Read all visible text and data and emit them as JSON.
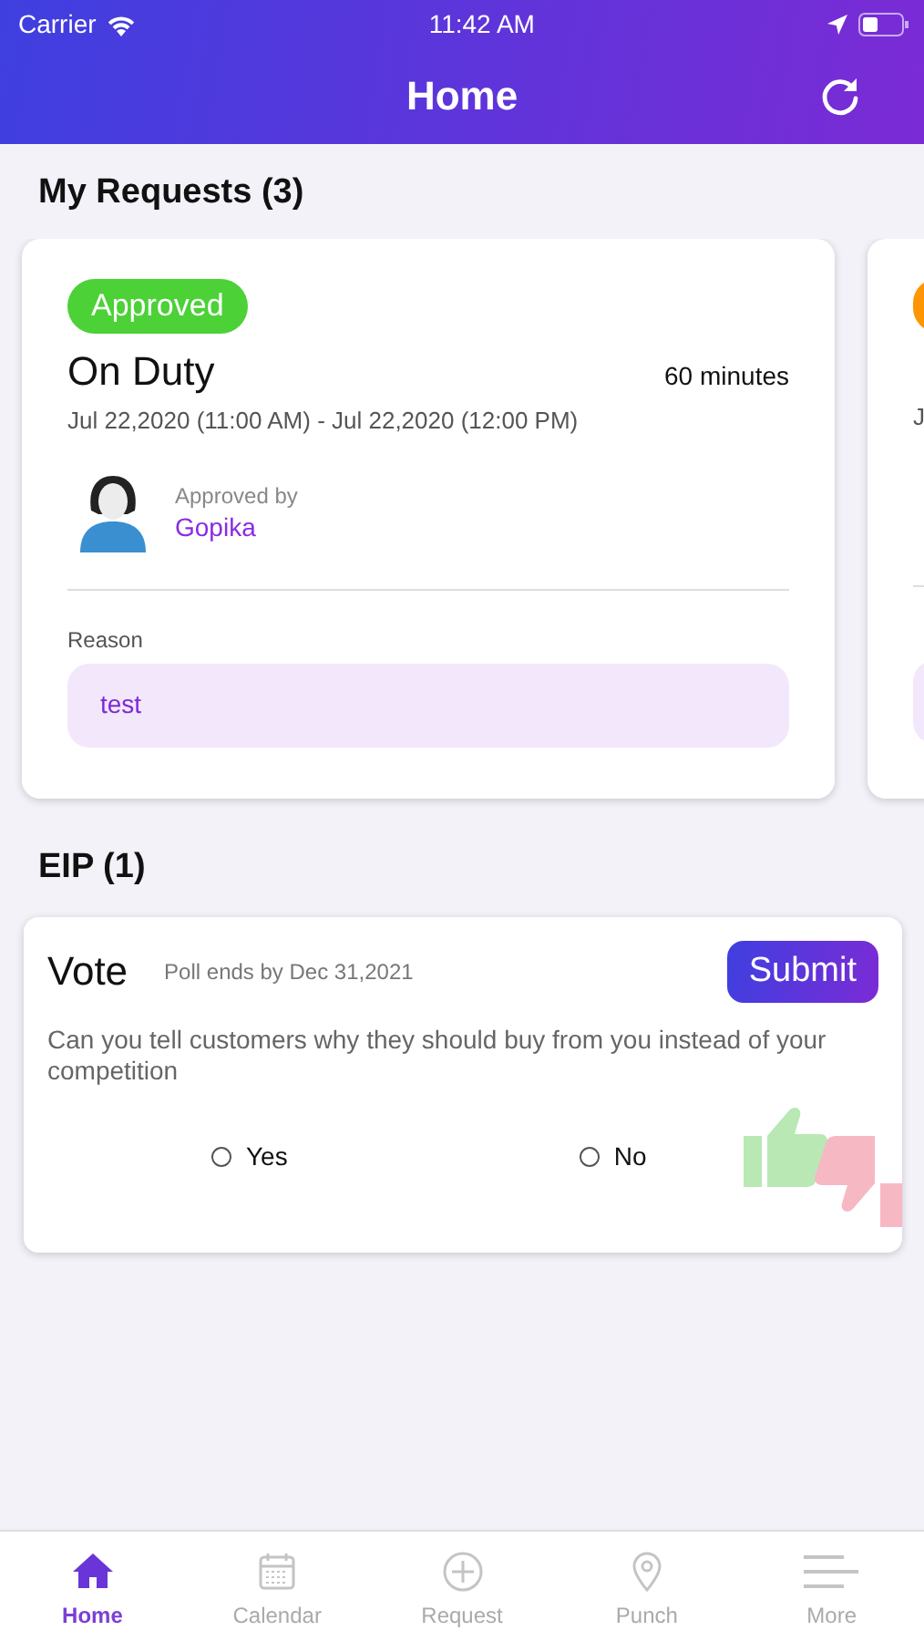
{
  "status_bar": {
    "carrier": "Carrier",
    "time": "11:42 AM"
  },
  "header": {
    "title": "Home"
  },
  "requests": {
    "heading": "My Requests (3)",
    "cards": [
      {
        "badge": "Approved",
        "color": "#4cd137",
        "title": "On Duty",
        "duration": "60 minutes",
        "dates": "Jul 22,2020 (11:00 AM) - Jul 22,2020 (12:00 PM)",
        "approver_label": "Approved by",
        "approver": "Gopika",
        "reason_label": "Reason",
        "reason": "test"
      },
      {
        "color": "#ff9500",
        "dates": "J"
      }
    ]
  },
  "eip": {
    "heading": "EIP (1)",
    "poll": {
      "title": "Vote",
      "deadline": "Poll ends by Dec 31,2021",
      "submit": "Submit",
      "question": "Can you tell customers why they should buy from you instead of your competition",
      "options": [
        {
          "label": "Yes",
          "selected": false
        },
        {
          "label": "No",
          "selected": false
        }
      ]
    }
  },
  "tabs": [
    {
      "label": "Home",
      "kind": "home",
      "selected": true
    },
    {
      "label": "Calendar",
      "kind": "calendar",
      "selected": false
    },
    {
      "label": "Request",
      "kind": "request",
      "selected": false
    },
    {
      "label": "Punch",
      "kind": "punch",
      "selected": false
    },
    {
      "label": "More",
      "kind": "more",
      "selected": false
    }
  ]
}
